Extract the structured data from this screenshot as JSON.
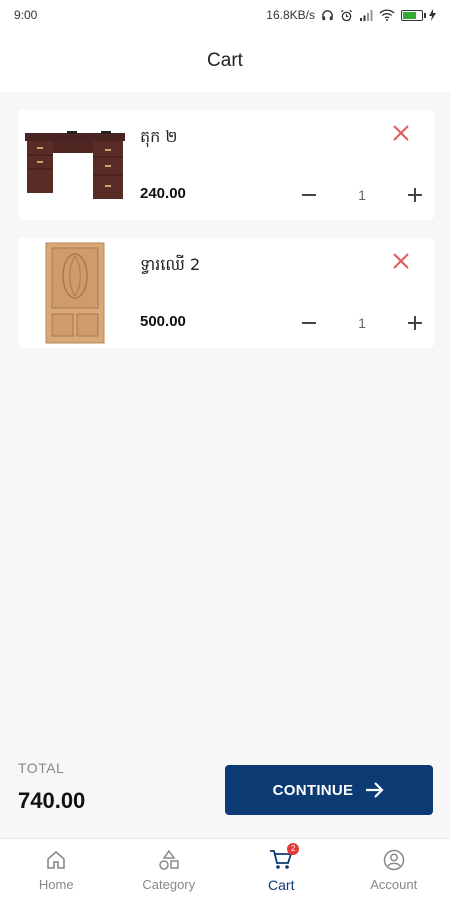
{
  "status_bar": {
    "time": "9:00",
    "network_speed": "16.8KB/s",
    "icons": [
      "headphones-icon",
      "alarm-icon",
      "signal-icon",
      "wifi-icon",
      "battery-icon",
      "charging-icon"
    ]
  },
  "header": {
    "title": "Cart"
  },
  "cart": {
    "items": [
      {
        "name": "តុក ២",
        "price": "240.00",
        "quantity": "1",
        "image": "office-desk-image"
      },
      {
        "name": "ទ្វារឈើ 2",
        "price": "500.00",
        "quantity": "1",
        "image": "wooden-door-image"
      }
    ]
  },
  "footer": {
    "total_label": "TOTAL",
    "total_value": "740.00",
    "continue_label": "CONTINUE"
  },
  "bottom_nav": {
    "items": [
      {
        "label": "Home",
        "icon": "home-icon"
      },
      {
        "label": "Category",
        "icon": "category-icon"
      },
      {
        "label": "Cart",
        "icon": "cart-icon",
        "badge": "2",
        "active": true
      },
      {
        "label": "Account",
        "icon": "account-icon"
      }
    ]
  },
  "colors": {
    "primary": "#0c3a72",
    "remove": "#e05a5a",
    "badge": "#e53935",
    "background": "#f7f7f7"
  }
}
